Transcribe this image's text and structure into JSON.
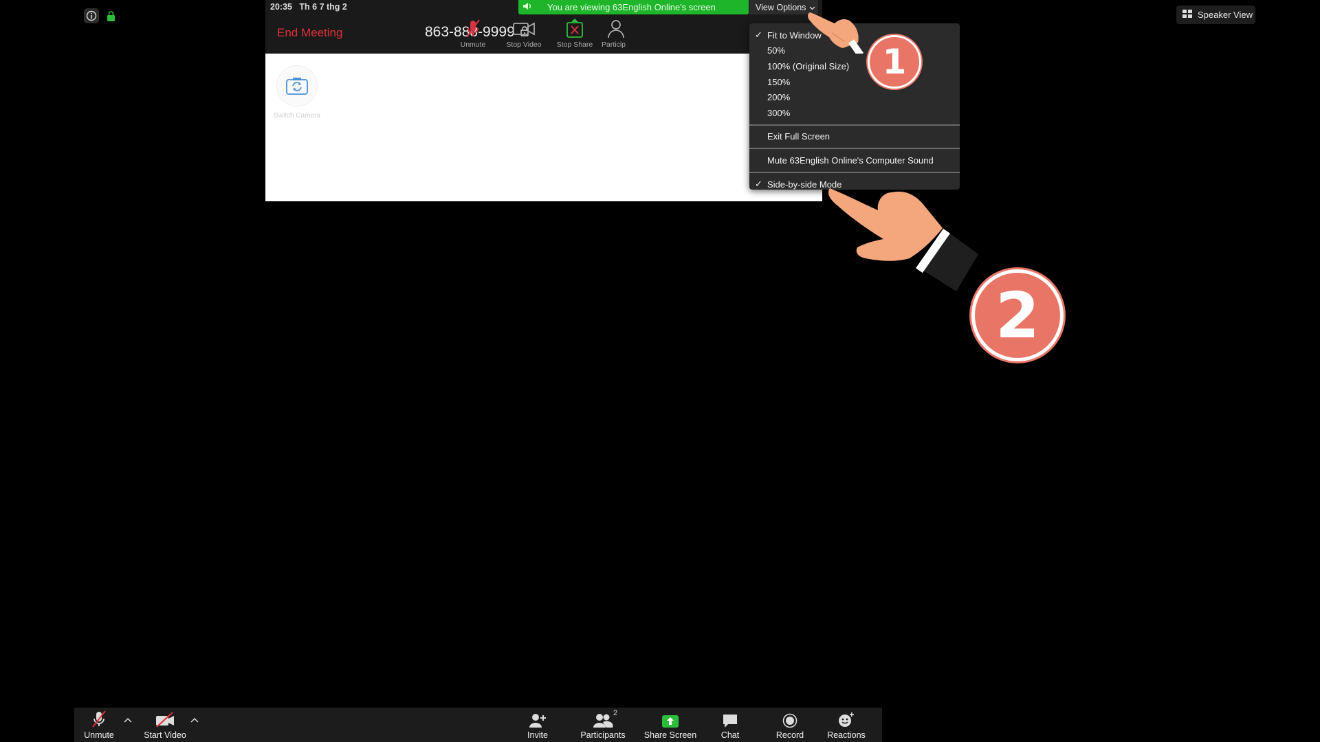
{
  "ipad": {
    "status_time": "20:35",
    "status_date": "Th 6 7 thg 2",
    "end_meeting": "End Meeting",
    "meeting_id": "863-888-9999",
    "tools": [
      {
        "label": "Unmute",
        "icon": "mic-muted-icon"
      },
      {
        "label": "Stop Video",
        "icon": "video-camera-icon"
      },
      {
        "label": "Stop Share",
        "icon": "stop-share-icon"
      },
      {
        "label": "Particip",
        "icon": "participants-icon"
      }
    ],
    "switch_camera_label": "Switch Camera"
  },
  "share_banner": {
    "text": "You are viewing 63English Online's screen"
  },
  "view_options": {
    "label": "View Options",
    "menu": {
      "zoom_items": [
        "Fit to Window",
        "50%",
        "100% (Original Size)",
        "150%",
        "200%",
        "300%"
      ],
      "checked_zoom": "Fit to Window",
      "exit_full_screen": "Exit Full Screen",
      "mute_sound": "Mute 63English Online's Computer Sound",
      "side_by_side": "Side-by-side Mode",
      "side_by_side_checked": true
    }
  },
  "speaker_view": {
    "label": "Speaker View",
    "icon": "grid-icon"
  },
  "annotations": {
    "step1": "1",
    "step2": "2"
  },
  "toolbar": {
    "unmute": "Unmute",
    "start_video": "Start Video",
    "invite": "Invite",
    "participants": "Participants",
    "participants_count": "2",
    "share_screen": "Share Screen",
    "chat": "Chat",
    "record": "Record",
    "reactions": "Reactions"
  },
  "colors": {
    "share_green": "#1fb52a",
    "end_meeting_red": "#e0303a",
    "badge_salmon": "#e97567",
    "skin": "#f4a77d"
  }
}
